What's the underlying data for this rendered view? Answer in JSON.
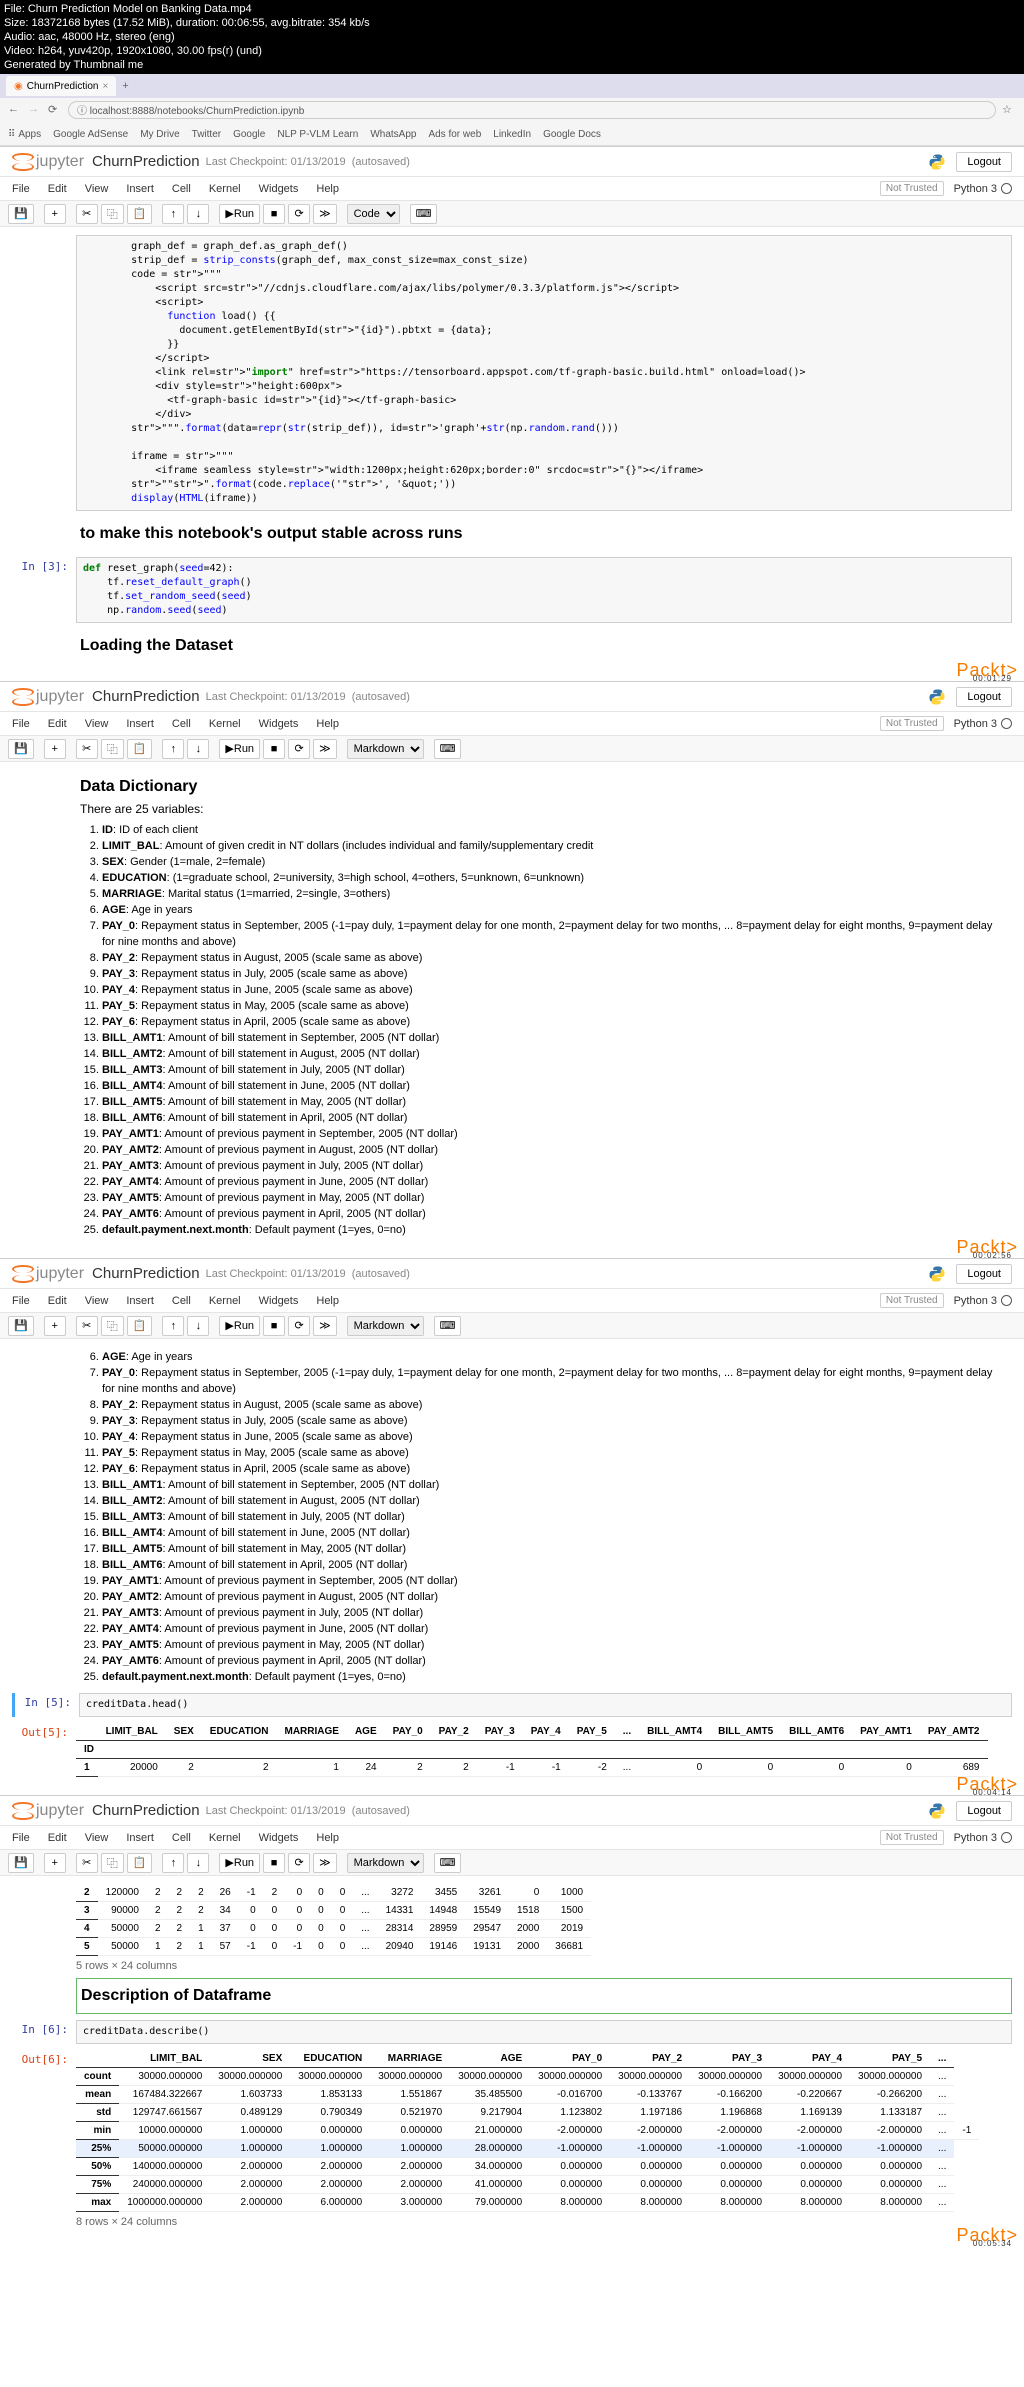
{
  "video_meta": {
    "file": "File: Churn Prediction Model on Banking Data.mp4",
    "size": "Size: 18372168 bytes (17.52 MiB), duration: 00:06:55, avg.bitrate: 354 kb/s",
    "audio": "Audio: aac, 48000 Hz, stereo (eng)",
    "video": "Video: h264, yuv420p, 1920x1080, 30.00 fps(r) (und)",
    "gen": "Generated by Thumbnail me"
  },
  "browser": {
    "tab": "ChurnPrediction",
    "url": "localhost:8888/notebooks/ChurnPrediction.ipynb",
    "bookmarks": [
      "Apps",
      "Google AdSense",
      "My Drive",
      "Twitter",
      "Google",
      "NLP P-VLM Learn",
      "WhatsApp",
      "Ads for web",
      "LinkedIn",
      "Google Docs"
    ]
  },
  "jupyter": {
    "logo": "jupyter",
    "title": "ChurnPrediction",
    "checkpoint": "Last Checkpoint: 01/13/2019",
    "autosaved": "(autosaved)",
    "logout": "Logout",
    "not_trusted": "Not Trusted",
    "kernel": "Python 3",
    "menus": [
      "File",
      "Edit",
      "View",
      "Insert",
      "Cell",
      "Kernel",
      "Widgets",
      "Help"
    ],
    "run": "Run",
    "celltype_code": "Code",
    "celltype_md": "Markdown"
  },
  "watermark": {
    "brand": "Packt",
    "suffix": ">"
  },
  "timestamps": {
    "s1": "00:01:29",
    "s2": "00:02:56",
    "s3": "00:04:14",
    "s4": "00:05:34"
  },
  "frame1": {
    "code": "        graph_def = graph_def.as_graph_def()\n        strip_def = strip_consts(graph_def, max_const_size=max_const_size)\n        code = \"\"\"\n            <script src=\"//cdnjs.cloudflare.com/ajax/libs/polymer/0.3.3/platform.js\"></script>\n            <script>\n              function load() {{\n                document.getElementById(\"{id}\").pbtxt = {data};\n              }}\n            </script>\n            <link rel=\"import\" href=\"https://tensorboard.appspot.com/tf-graph-basic.build.html\" onload=load()>\n            <div style=\"height:600px\">\n              <tf-graph-basic id=\"{id}\"></tf-graph-basic>\n            </div>\n        \"\"\".format(data=repr(str(strip_def)), id='graph'+str(np.random.rand()))\n\n        iframe = \"\"\"\n            <iframe seamless style=\"width:1200px;height:620px;border:0\" srcdoc=\"{}\"></iframe>\n        \"\"\".format(code.replace('\"', '&quot;'))\n        display(HTML(iframe))",
    "md_heading": "to make this notebook's output stable across runs",
    "cell3_prompt": "In [3]:",
    "cell3_code": "def reset_graph(seed=42):\n    tf.reset_default_graph()\n    tf.set_random_seed(seed)\n    np.random.seed(seed)",
    "loading_heading": "Loading the Dataset"
  },
  "frame2": {
    "heading": "Data Dictionary",
    "intro": "There are 25 variables:",
    "vars": [
      {
        "k": "ID",
        "v": ": ID of each client"
      },
      {
        "k": "LIMIT_BAL",
        "v": ": Amount of given credit in NT dollars (includes individual and family/supplementary credit"
      },
      {
        "k": "SEX",
        "v": ": Gender (1=male, 2=female)"
      },
      {
        "k": "EDUCATION",
        "v": ": (1=graduate school, 2=university, 3=high school, 4=others, 5=unknown, 6=unknown)"
      },
      {
        "k": "MARRIAGE",
        "v": ": Marital status (1=married, 2=single, 3=others)"
      },
      {
        "k": "AGE",
        "v": ": Age in years"
      },
      {
        "k": "PAY_0",
        "v": ": Repayment status in September, 2005 (-1=pay duly, 1=payment delay for one month, 2=payment delay for two months, ... 8=payment delay for eight months, 9=payment delay for nine months and above)"
      },
      {
        "k": "PAY_2",
        "v": ": Repayment status in August, 2005 (scale same as above)"
      },
      {
        "k": "PAY_3",
        "v": ": Repayment status in July, 2005 (scale same as above)"
      },
      {
        "k": "PAY_4",
        "v": ": Repayment status in June, 2005 (scale same as above)"
      },
      {
        "k": "PAY_5",
        "v": ": Repayment status in May, 2005 (scale same as above)"
      },
      {
        "k": "PAY_6",
        "v": ": Repayment status in April, 2005 (scale same as above)"
      },
      {
        "k": "BILL_AMT1",
        "v": ": Amount of bill statement in September, 2005 (NT dollar)"
      },
      {
        "k": "BILL_AMT2",
        "v": ": Amount of bill statement in August, 2005 (NT dollar)"
      },
      {
        "k": "BILL_AMT3",
        "v": ": Amount of bill statement in July, 2005 (NT dollar)"
      },
      {
        "k": "BILL_AMT4",
        "v": ": Amount of bill statement in June, 2005 (NT dollar)"
      },
      {
        "k": "BILL_AMT5",
        "v": ": Amount of bill statement in May, 2005 (NT dollar)"
      },
      {
        "k": "BILL_AMT6",
        "v": ": Amount of bill statement in April, 2005 (NT dollar)"
      },
      {
        "k": "PAY_AMT1",
        "v": ": Amount of previous payment in September, 2005 (NT dollar)"
      },
      {
        "k": "PAY_AMT2",
        "v": ": Amount of previous payment in August, 2005 (NT dollar)"
      },
      {
        "k": "PAY_AMT3",
        "v": ": Amount of previous payment in July, 2005 (NT dollar)"
      },
      {
        "k": "PAY_AMT4",
        "v": ": Amount of previous payment in June, 2005 (NT dollar)"
      },
      {
        "k": "PAY_AMT5",
        "v": ": Amount of previous payment in May, 2005 (NT dollar)"
      },
      {
        "k": "PAY_AMT6",
        "v": ": Amount of previous payment in April, 2005 (NT dollar)"
      },
      {
        "k": "default.payment.next.month",
        "v": ": Default payment (1=yes, 0=no)"
      }
    ]
  },
  "frame3": {
    "start6": "AGE: Age in years",
    "cell5_prompt": "In [5]:",
    "cell5_code": "creditData.head()",
    "out5": "Out[5]:",
    "table_cols": [
      "LIMIT_BAL",
      "SEX",
      "EDUCATION",
      "MARRIAGE",
      "AGE",
      "PAY_0",
      "PAY_2",
      "PAY_3",
      "PAY_4",
      "PAY_5",
      "...",
      "BILL_AMT4",
      "BILL_AMT5",
      "BILL_AMT6",
      "PAY_AMT1",
      "PAY_AMT2"
    ],
    "idx_name": "ID",
    "row1": [
      "1",
      "20000",
      "2",
      "2",
      "1",
      "24",
      "2",
      "2",
      "-1",
      "-1",
      "-2",
      "...",
      "0",
      "0",
      "0",
      "0",
      "689"
    ]
  },
  "frame4": {
    "head_rows": [
      [
        "2",
        "120000",
        "2",
        "2",
        "2",
        "26",
        "-1",
        "2",
        "0",
        "0",
        "0",
        "...",
        "3272",
        "3455",
        "3261",
        "0",
        "1000"
      ],
      [
        "3",
        "90000",
        "2",
        "2",
        "2",
        "34",
        "0",
        "0",
        "0",
        "0",
        "0",
        "...",
        "14331",
        "14948",
        "15549",
        "1518",
        "1500"
      ],
      [
        "4",
        "50000",
        "2",
        "2",
        "1",
        "37",
        "0",
        "0",
        "0",
        "0",
        "0",
        "...",
        "28314",
        "28959",
        "29547",
        "2000",
        "2019"
      ],
      [
        "5",
        "50000",
        "1",
        "2",
        "1",
        "57",
        "-1",
        "0",
        "-1",
        "0",
        "0",
        "...",
        "20940",
        "19146",
        "19131",
        "2000",
        "36681"
      ]
    ],
    "shape_note": "5 rows × 24 columns",
    "desc_heading": "Description of Dataframe",
    "cell6_prompt": "In [6]:",
    "cell6_code": "creditData.describe()",
    "out6": "Out[6]:",
    "desc_cols": [
      "",
      "LIMIT_BAL",
      "SEX",
      "EDUCATION",
      "MARRIAGE",
      "AGE",
      "PAY_0",
      "PAY_2",
      "PAY_3",
      "PAY_4",
      "PAY_5",
      "..."
    ],
    "desc_rows": [
      [
        "count",
        "30000.000000",
        "30000.000000",
        "30000.000000",
        "30000.000000",
        "30000.000000",
        "30000.000000",
        "30000.000000",
        "30000.000000",
        "30000.000000",
        "30000.000000",
        "..."
      ],
      [
        "mean",
        "167484.322667",
        "1.603733",
        "1.853133",
        "1.551867",
        "35.485500",
        "-0.016700",
        "-0.133767",
        "-0.166200",
        "-0.220667",
        "-0.266200",
        "..."
      ],
      [
        "std",
        "129747.661567",
        "0.489129",
        "0.790349",
        "0.521970",
        "9.217904",
        "1.123802",
        "1.197186",
        "1.196868",
        "1.169139",
        "1.133187",
        "..."
      ],
      [
        "min",
        "10000.000000",
        "1.000000",
        "0.000000",
        "0.000000",
        "21.000000",
        "-2.000000",
        "-2.000000",
        "-2.000000",
        "-2.000000",
        "-2.000000",
        "...",
        "-1"
      ],
      [
        "25%",
        "50000.000000",
        "1.000000",
        "1.000000",
        "1.000000",
        "28.000000",
        "-1.000000",
        "-1.000000",
        "-1.000000",
        "-1.000000",
        "-1.000000",
        "..."
      ],
      [
        "50%",
        "140000.000000",
        "2.000000",
        "2.000000",
        "2.000000",
        "34.000000",
        "0.000000",
        "0.000000",
        "0.000000",
        "0.000000",
        "0.000000",
        "..."
      ],
      [
        "75%",
        "240000.000000",
        "2.000000",
        "2.000000",
        "2.000000",
        "41.000000",
        "0.000000",
        "0.000000",
        "0.000000",
        "0.000000",
        "0.000000",
        "..."
      ],
      [
        "max",
        "1000000.000000",
        "2.000000",
        "6.000000",
        "3.000000",
        "79.000000",
        "8.000000",
        "8.000000",
        "8.000000",
        "8.000000",
        "8.000000",
        "..."
      ]
    ],
    "shape_note2": "8 rows × 24 columns"
  }
}
